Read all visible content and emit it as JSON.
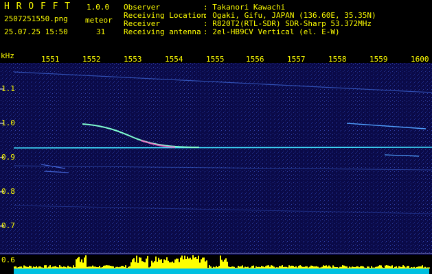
{
  "app": {
    "title": "H R O F F T",
    "version": "1.0.0",
    "filename": "2507251550.png",
    "datetime": "25.07.25 15:50",
    "meteor_label": "meteor",
    "meteor_count": "31"
  },
  "info": {
    "observer_label": "Observer",
    "observer_value": ": Takanori Kawachi",
    "location_label": "Receiving Location",
    "location_value": ": Ogaki, Gifu, JAPAN (136.60E, 35.35N)",
    "receiver_label": "Receiver",
    "receiver_value": ": R820T2(RTL-SDR) SDR-Sharp 53.372MHz",
    "antenna_label": "Receiving antenna",
    "antenna_value": ": 2el-HB9CV Vertical (el. E-W)"
  },
  "axis": {
    "y_unit": "kHz",
    "y_ticks": [
      "1.1",
      "1.0",
      "0.9",
      "0.8",
      "0.7",
      "0.6"
    ],
    "x_ticks": [
      "1551",
      "1552",
      "1553",
      "1554",
      "1555",
      "1556",
      "1557",
      "1558",
      "1559",
      "1600"
    ]
  },
  "colors": {
    "label_text": "#ffff00",
    "background": "#000000",
    "spectrogram_bg": "#0a0a45",
    "signal_cyan": "#40e0ff",
    "activity_bars": "#ffff00"
  }
}
